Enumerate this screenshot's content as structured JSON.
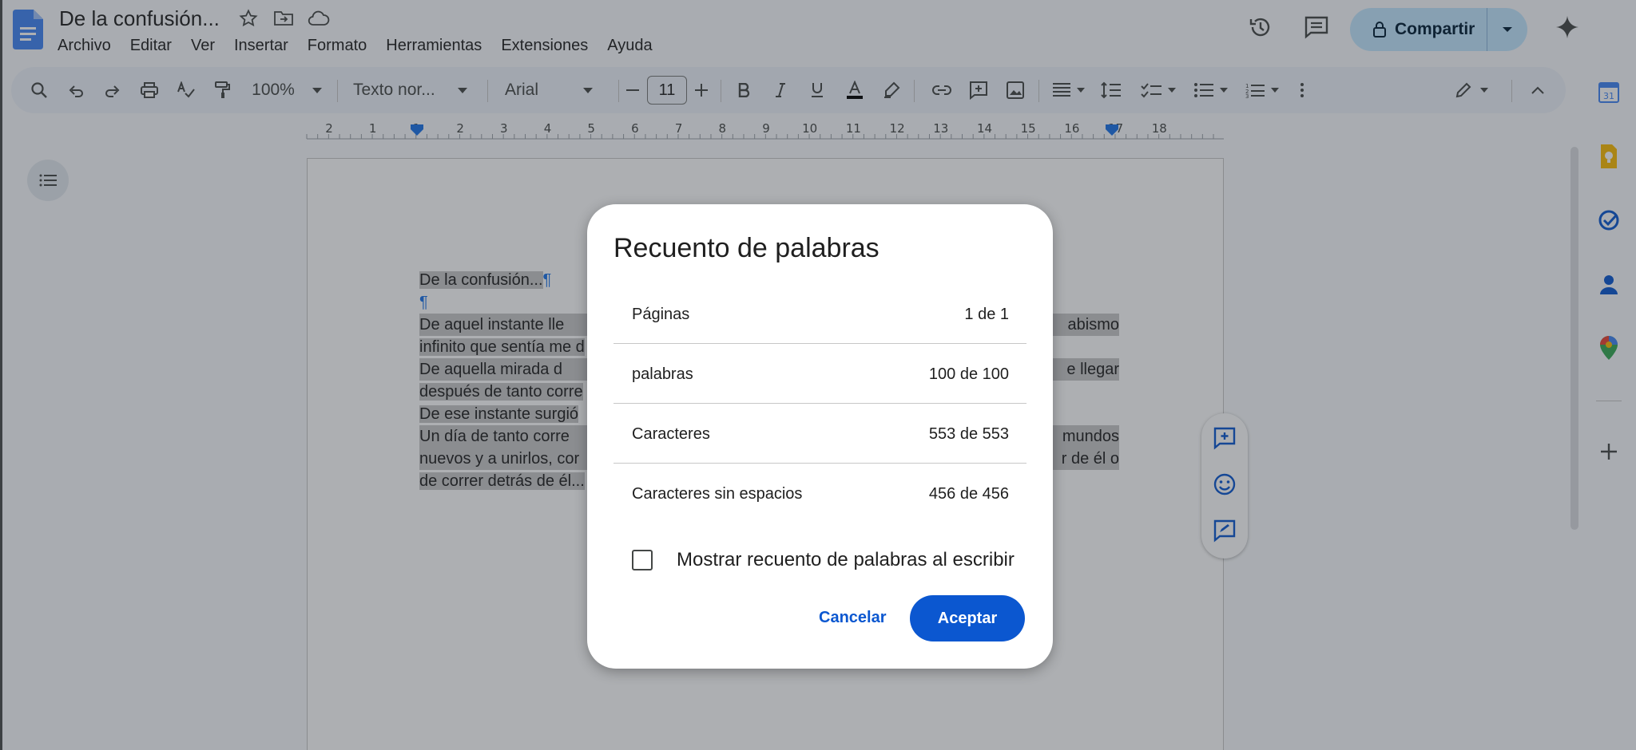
{
  "document": {
    "title": "De la confusión...",
    "paragraphs": [
      "De la confusión...",
      "",
      "De aquel instante llegó el abismo infinito que sentía me d",
      "De aquella mirada de luz llegó el deseo de llegar después de tanto corre",
      "De ese instante surgió",
      "Un día de tanto correr llegó a conocer mundos nuevos y a unirlos, cor corrías detrás de él o de correr detrás de él..."
    ],
    "lines": [
      "De la confusión...",
      "",
      "De aquel instante lle",
      "infinito que sentía me d",
      "De aquella mirada d",
      "después de tanto corre",
      "De ese instante surgió",
      "Un día de tanto corre",
      "nuevos y a unirlos, cor",
      "de correr detrás de él..."
    ],
    "right_fragments": [
      "abismo",
      "e llegar",
      "mundos",
      "r de él o"
    ]
  },
  "menu": [
    "Archivo",
    "Editar",
    "Ver",
    "Insertar",
    "Formato",
    "Herramientas",
    "Extensiones",
    "Ayuda"
  ],
  "header": {
    "share_label": "Compartir"
  },
  "toolbar": {
    "zoom": "100%",
    "style": "Texto nor...",
    "font": "Arial",
    "font_size": "11"
  },
  "ruler": {
    "ticks": [
      "2",
      "1",
      "1",
      "2",
      "3",
      "4",
      "5",
      "6",
      "7",
      "8",
      "9",
      "10",
      "11",
      "12",
      "13",
      "14",
      "15",
      "16",
      "17",
      "18"
    ]
  },
  "dialog": {
    "title": "Recuento de palabras",
    "stats": [
      {
        "label": "Páginas",
        "value": "1 de 1"
      },
      {
        "label": "palabras",
        "value": "100 de 100"
      },
      {
        "label": "Caracteres",
        "value": "553 de 553"
      },
      {
        "label": "Caracteres sin espacios",
        "value": "456 de 456"
      }
    ],
    "checkbox_label": "Mostrar recuento de palabras al escribir",
    "checkbox_checked": false,
    "cancel_label": "Cancelar",
    "ok_label": "Aceptar"
  },
  "colors": {
    "accent": "#0b57d0",
    "share_bg": "#c2e7ff",
    "selection": "#c8c8c8"
  }
}
